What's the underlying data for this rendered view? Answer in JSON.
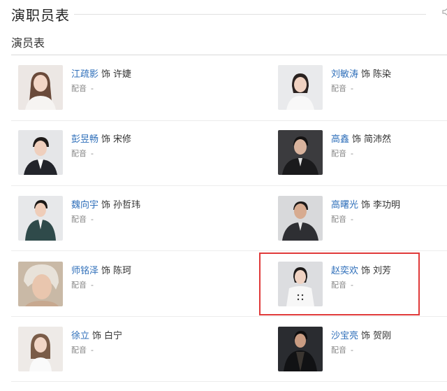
{
  "header": {
    "title": "演职员表"
  },
  "section": {
    "title": "演员表"
  },
  "cast": [
    {
      "actor": "江疏影",
      "as": "饰",
      "role": "许婕",
      "voice_label": "配音",
      "voice_value": "-"
    },
    {
      "actor": "刘敏涛",
      "as": "饰",
      "role": "陈染",
      "voice_label": "配音",
      "voice_value": "-"
    },
    {
      "actor": "彭昱畅",
      "as": "饰",
      "role": "宋修",
      "voice_label": "配音",
      "voice_value": "-"
    },
    {
      "actor": "高鑫",
      "as": "饰",
      "role": "简沛然",
      "voice_label": "配音",
      "voice_value": "-"
    },
    {
      "actor": "魏向宇",
      "as": "饰",
      "role": "孙哲玮",
      "voice_label": "配音",
      "voice_value": "-"
    },
    {
      "actor": "高曙光",
      "as": "饰",
      "role": "李功明",
      "voice_label": "配音",
      "voice_value": "-"
    },
    {
      "actor": "师铭泽",
      "as": "饰",
      "role": "陈珂",
      "voice_label": "配音",
      "voice_value": "-"
    },
    {
      "actor": "赵奕欢",
      "as": "饰",
      "role": "刘芳",
      "voice_label": "配音",
      "voice_value": "-"
    },
    {
      "actor": "徐立",
      "as": "饰",
      "role": "白宁",
      "voice_label": "配音",
      "voice_value": "-"
    },
    {
      "actor": "沙宝亮",
      "as": "饰",
      "role": "贺刚",
      "voice_label": "配音",
      "voice_value": "-"
    }
  ],
  "colors": {
    "link": "#2f6fba",
    "highlight": "#e03a3a"
  },
  "icons": {
    "speaker": "speaker-icon"
  }
}
